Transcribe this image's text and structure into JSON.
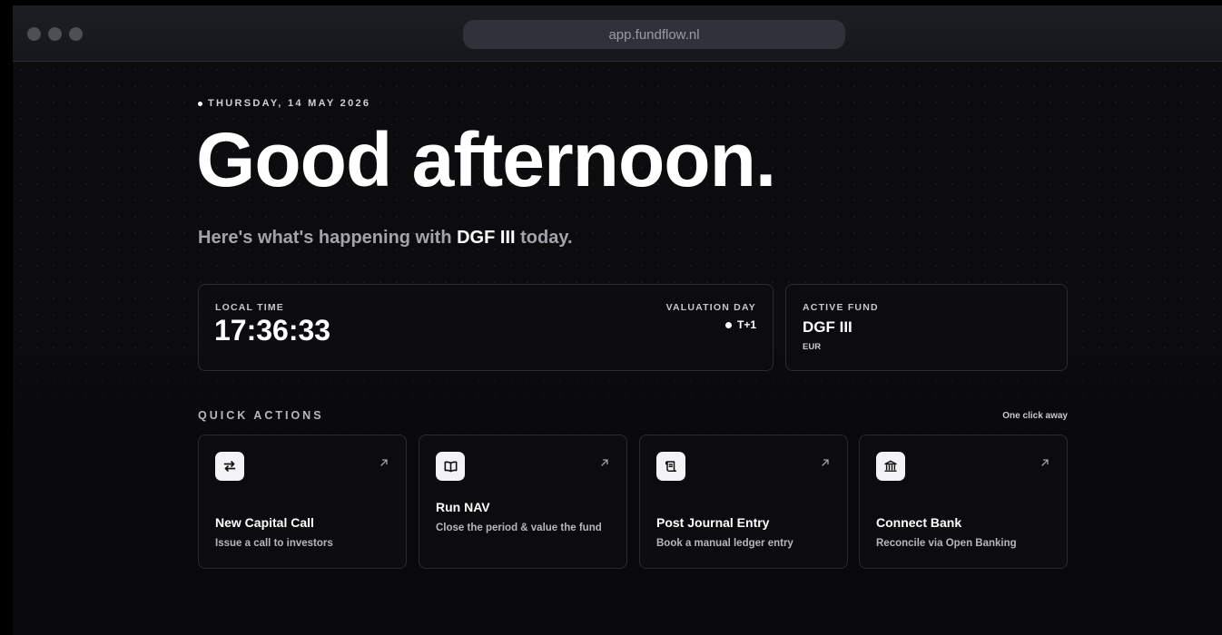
{
  "browser": {
    "url": "app.fundflow.nl"
  },
  "header": {
    "date": "THURSDAY, 14 MAY 2026",
    "greeting": "Good afternoon.",
    "subtitle_prefix": "Here's what's happening with ",
    "subtitle_fund": "DGF III",
    "subtitle_suffix": " today."
  },
  "status": {
    "local_time_label": "LOCAL TIME",
    "local_time": "17:36:33",
    "valuation_label": "VALUATION DAY",
    "valuation_value": "T+1",
    "active_fund_label": "ACTIVE FUND",
    "active_fund": "DGF III",
    "currency": "EUR"
  },
  "quick_actions": {
    "title": "QUICK ACTIONS",
    "hint": "One click away",
    "items": [
      {
        "icon": "transfer-arrows-icon",
        "title": "New Capital Call",
        "description": "Issue a call to investors"
      },
      {
        "icon": "open-book-icon",
        "title": "Run NAV",
        "description": "Close the period & value the fund"
      },
      {
        "icon": "scroll-icon",
        "title": "Post Journal Entry",
        "description": "Book a manual ledger entry"
      },
      {
        "icon": "bank-icon",
        "title": "Connect Bank",
        "description": "Reconcile via Open Banking"
      }
    ]
  }
}
